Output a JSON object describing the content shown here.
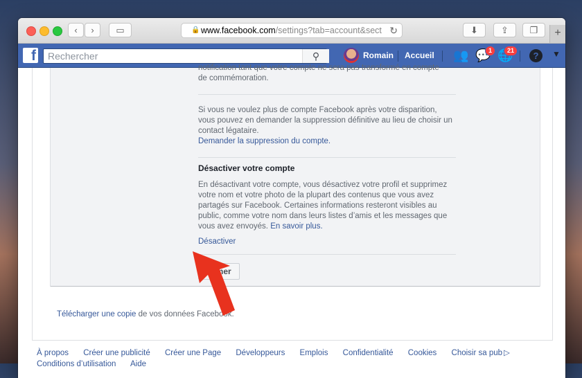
{
  "browser": {
    "url_host": "www.facebook.com",
    "url_path": "/settings?tab=account&sect",
    "reload_icon": "reload-icon",
    "lock_icon": "lock-icon"
  },
  "fb": {
    "search_placeholder": "Rechercher",
    "user_name": "Romain",
    "home_label": "Accueil",
    "messenger_badge": "1",
    "notif_badge": "21",
    "help_glyph": "?"
  },
  "settings": {
    "memorial_text_tail": "notification tant que votre compte ne sera pas transformé en compte",
    "memorial_text_end": "de commémoration.",
    "delete_text": "Si vous ne voulez plus de compte Facebook après votre disparition, vous pouvez en demander la suppression définitive au lieu de choisir un contact légataire.",
    "delete_link": "Demander la suppression du compte.",
    "deactivate_heading": "Désactiver votre compte",
    "deactivate_text": "En désactivant votre compte, vous désactivez votre profil et supprimez votre nom et votre photo de la plupart des contenus que vous avez partagés sur Facebook. Certaines informations resteront visibles au public, comme votre nom dans leurs listes d’amis et les messages que vous avez envoyés.",
    "learn_more": "En savoir plus.",
    "deactivate_link": "Désactiver",
    "close_button": "Fermer"
  },
  "download": {
    "link": "Télécharger une copie",
    "rest": "de vos données Facebook."
  },
  "footer": {
    "items": [
      "À propos",
      "Créer une publicité",
      "Créer une Page",
      "Développeurs",
      "Emplois",
      "Confidentialité",
      "Cookies",
      "Choisir sa pub"
    ],
    "items2": [
      "Conditions d’utilisation",
      "Aide"
    ]
  },
  "colors": {
    "fb_blue": "#4267b2",
    "link": "#365899",
    "arrow": "#e8321e"
  }
}
